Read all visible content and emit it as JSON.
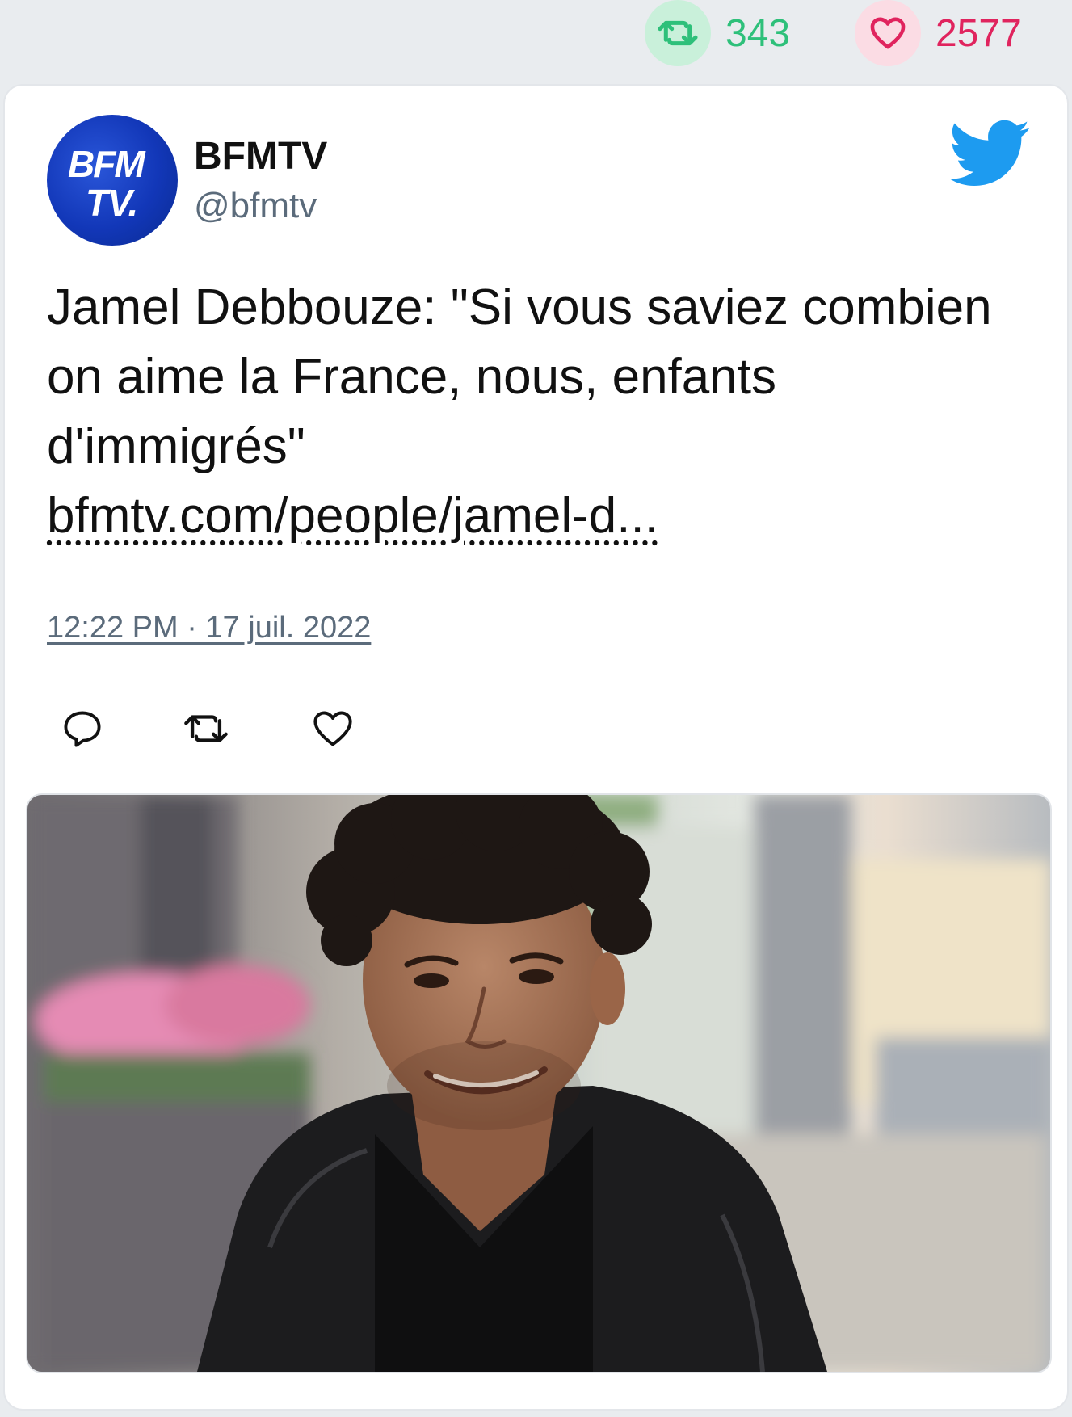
{
  "stats": {
    "retweets": "343",
    "likes": "2577",
    "retweet_icon": "retweet-icon",
    "like_icon": "heart-icon",
    "retweet_color": "#2ec07a",
    "like_color": "#e0245e"
  },
  "tweet": {
    "avatar_line1": "BFM",
    "avatar_line2": "TV.",
    "author_name": "BFMTV",
    "author_handle": "@bfmtv",
    "text": "Jamel Debbouze: \"Si vous saviez combien on aime la France, nous, enfants d'immigrés\"",
    "link": "bfmtv.com/people/jamel-d...",
    "timestamp": "12:22 PM · 17 juil. 2022",
    "brand_color": "#1d9bf0"
  },
  "actions": [
    {
      "icon": "reply-icon"
    },
    {
      "icon": "retweet-icon"
    },
    {
      "icon": "like-icon"
    }
  ]
}
